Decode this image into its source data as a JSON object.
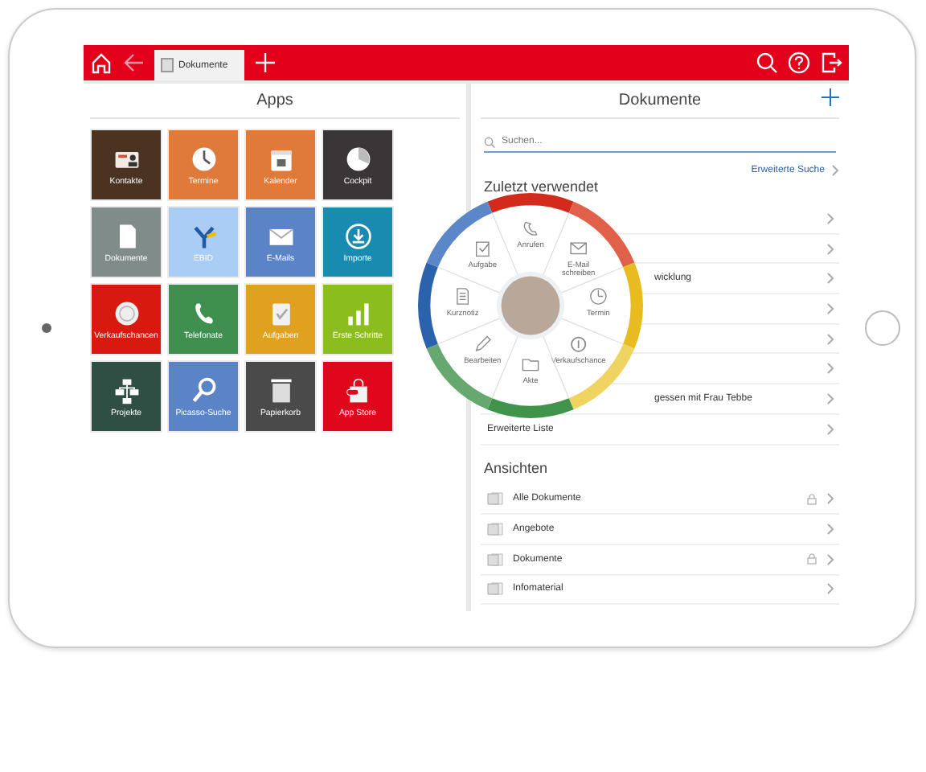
{
  "top_bar": {
    "tabs": [
      {
        "label": "Dokumente",
        "selected": true
      }
    ]
  },
  "apps": {
    "title": "Apps",
    "tiles": [
      {
        "label": "Kontakte",
        "color": "#4a3421"
      },
      {
        "label": "Termine",
        "color": "#e07a3a"
      },
      {
        "label": "Kalender",
        "color": "#e07a3a"
      },
      {
        "label": "Cockpit",
        "color": "#3a3536"
      },
      {
        "label": "Dokumente",
        "color": "#7f8c8a"
      },
      {
        "label": "EBID",
        "color": "#a9cdf5"
      },
      {
        "label": "E-Mails",
        "color": "#5b84c7"
      },
      {
        "label": "Importe",
        "color": "#1a8bb0"
      },
      {
        "label": "Verkaufschancen",
        "color": "#d8190f"
      },
      {
        "label": "Telefonate",
        "color": "#3f8f4f"
      },
      {
        "label": "Aufgaben",
        "color": "#e0a020"
      },
      {
        "label": "Erste Schritte",
        "color": "#8cbd1f"
      },
      {
        "label": "Projekte",
        "color": "#2f4f45"
      },
      {
        "label": "Picasso-Suche",
        "color": "#5b84c7"
      },
      {
        "label": "Papierkorb",
        "color": "#4a4a4a"
      },
      {
        "label": "App Store",
        "color": "#e0061c"
      }
    ]
  },
  "documents": {
    "title": "Dokumente",
    "search": {
      "placeholder": "Suchen..."
    },
    "advanced_search": "Erweiterte Suche",
    "recent": {
      "heading": "Zuletzt verwendet",
      "rows": [
        {
          "label": ""
        },
        {
          "label": ""
        },
        {
          "label": "wicklung"
        },
        {
          "label": ""
        },
        {
          "label": ""
        },
        {
          "label": ""
        },
        {
          "label": "gessen mit Frau Tebbe"
        }
      ]
    },
    "more_list": "Erweiterte Liste",
    "views": {
      "heading": "Ansichten",
      "rows": [
        {
          "label": "Alle Dokumente",
          "locked": true
        },
        {
          "label": "Angebote",
          "locked": false
        },
        {
          "label": "Dokumente",
          "locked": true
        },
        {
          "label": "Infomaterial",
          "locked": false
        }
      ]
    }
  },
  "radial_menu": {
    "items": [
      {
        "label": "Anrufen",
        "color": "#d42a1c"
      },
      {
        "label": "E-Mail schreiben",
        "color": "#e0604a"
      },
      {
        "label": "Termin",
        "color": "#e8bc1e"
      },
      {
        "label": "Verkaufschance",
        "color": "#f0d462"
      },
      {
        "label": "Akte",
        "color": "#3f934a"
      },
      {
        "label": "Bearbeiten",
        "color": "#67a86e"
      },
      {
        "label": "Kurznotiz",
        "color": "#2a62ac"
      },
      {
        "label": "Aufgabe",
        "color": "#5b86c8"
      }
    ]
  }
}
